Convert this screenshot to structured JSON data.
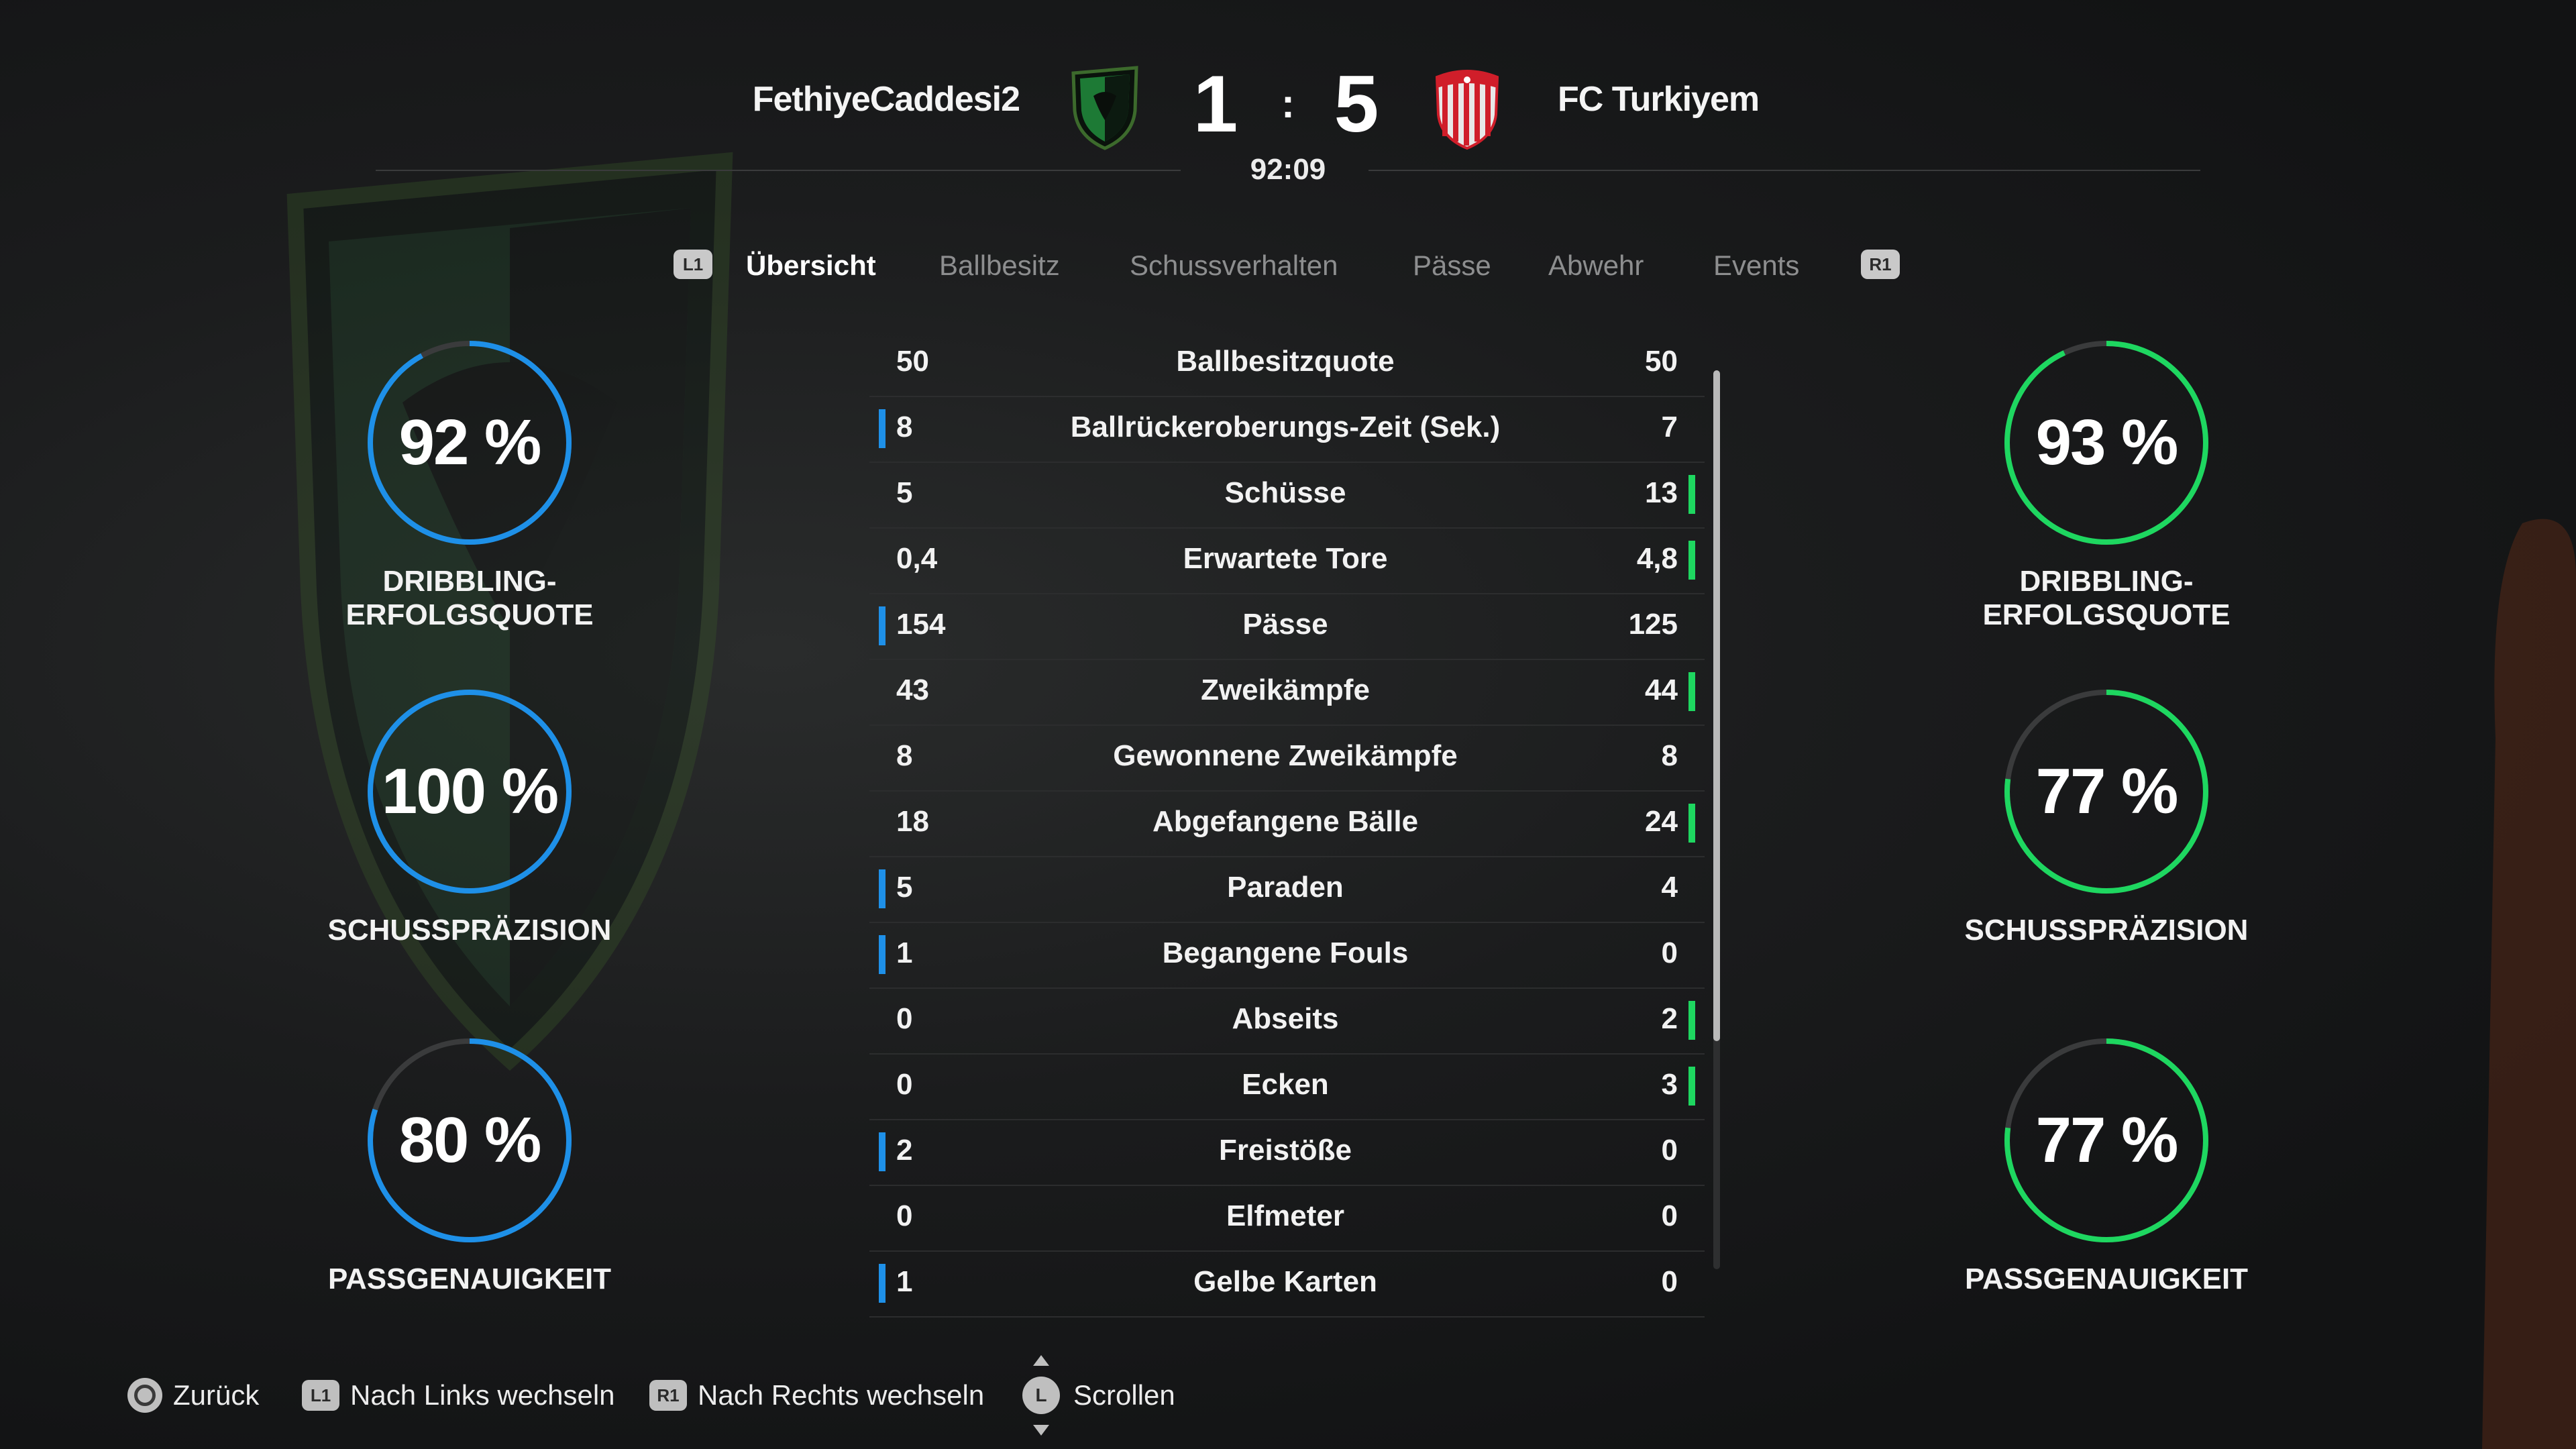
{
  "match": {
    "home_team": "FethiyeCaddesi2",
    "away_team": "FC Turkiyem",
    "home_score": "1",
    "away_score": "5",
    "separator": ":",
    "time": "92:09"
  },
  "tabs": {
    "left_bumper": "L1",
    "right_bumper": "R1",
    "items": [
      {
        "label": "Übersicht",
        "active": true
      },
      {
        "label": "Ballbesitz",
        "active": false
      },
      {
        "label": "Schussverhalten",
        "active": false
      },
      {
        "label": "Pässe",
        "active": false
      },
      {
        "label": "Abwehr",
        "active": false
      },
      {
        "label": "Events",
        "active": false
      }
    ]
  },
  "home_gauges": [
    {
      "value": "92 %",
      "percent": 92,
      "label": "DRIBBLING-ERFOLGSQUOTE"
    },
    {
      "value": "100 %",
      "percent": 100,
      "label": "SCHUSSPRÄZISION"
    },
    {
      "value": "80 %",
      "percent": 80,
      "label": "PASSGENAUIGKEIT"
    }
  ],
  "away_gauges": [
    {
      "value": "93 %",
      "percent": 93,
      "label": "DRIBBLING-ERFOLGSQUOTE"
    },
    {
      "value": "77 %",
      "percent": 77,
      "label": "SCHUSSPRÄZISION"
    },
    {
      "value": "77 %",
      "percent": 77,
      "label": "PASSGENAUIGKEIT"
    }
  ],
  "stats": [
    {
      "name": "Ballbesitzquote",
      "home": "50",
      "away": "50",
      "lead": "none"
    },
    {
      "name": "Ballrückeroberungs-Zeit (Sek.)",
      "home": "8",
      "away": "7",
      "lead": "home"
    },
    {
      "name": "Schüsse",
      "home": "5",
      "away": "13",
      "lead": "away"
    },
    {
      "name": "Erwartete Tore",
      "home": "0,4",
      "away": "4,8",
      "lead": "away"
    },
    {
      "name": "Pässe",
      "home": "154",
      "away": "125",
      "lead": "home"
    },
    {
      "name": "Zweikämpfe",
      "home": "43",
      "away": "44",
      "lead": "away"
    },
    {
      "name": "Gewonnene Zweikämpfe",
      "home": "8",
      "away": "8",
      "lead": "none"
    },
    {
      "name": "Abgefangene Bälle",
      "home": "18",
      "away": "24",
      "lead": "away"
    },
    {
      "name": "Paraden",
      "home": "5",
      "away": "4",
      "lead": "home"
    },
    {
      "name": "Begangene Fouls",
      "home": "1",
      "away": "0",
      "lead": "home"
    },
    {
      "name": "Abseits",
      "home": "0",
      "away": "2",
      "lead": "away"
    },
    {
      "name": "Ecken",
      "home": "0",
      "away": "3",
      "lead": "away"
    },
    {
      "name": "Freistöße",
      "home": "2",
      "away": "0",
      "lead": "home"
    },
    {
      "name": "Elfmeter",
      "home": "0",
      "away": "0",
      "lead": "none"
    },
    {
      "name": "Gelbe Karten",
      "home": "1",
      "away": "0",
      "lead": "home"
    }
  ],
  "footer": {
    "back": {
      "icon": "circle-button-icon",
      "label": "Zurück"
    },
    "left": {
      "button": "L1",
      "label": "Nach Links wechseln"
    },
    "right": {
      "button": "R1",
      "label": "Nach Rechts wechseln"
    },
    "scroll": {
      "button": "L",
      "label": "Scrollen"
    }
  },
  "colors": {
    "home_accent": "#1e90e8",
    "away_accent": "#1ed760",
    "gauge_track": "#3a3b3c"
  }
}
